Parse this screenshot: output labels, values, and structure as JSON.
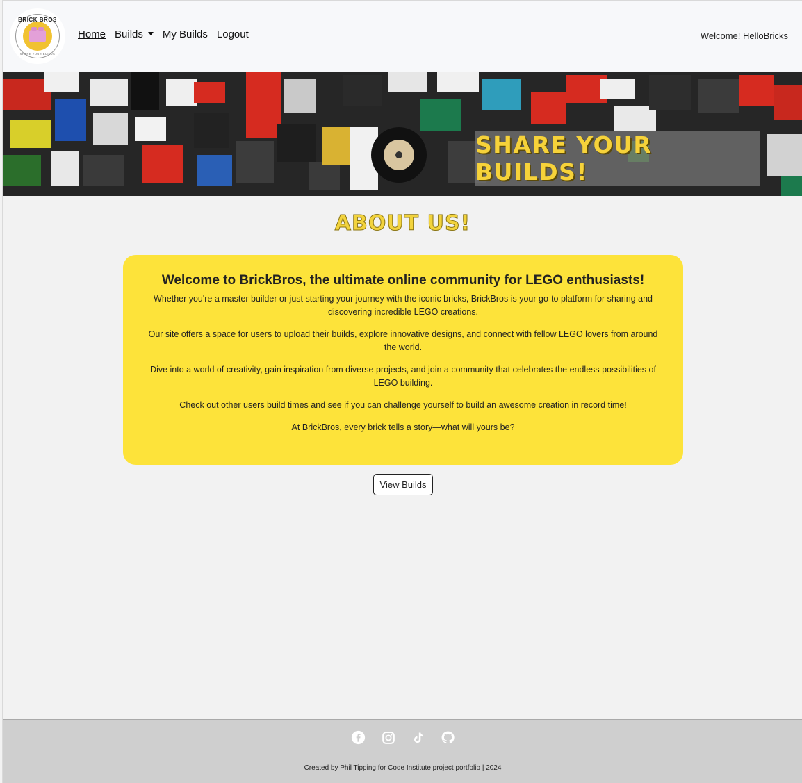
{
  "nav": {
    "logo_top_text": "BRICK BROS",
    "logo_bottom_text": "SHARE YOUR BUILDS",
    "links": [
      {
        "label": "Home"
      },
      {
        "label": "Builds"
      },
      {
        "label": "My Builds"
      },
      {
        "label": "Logout"
      }
    ],
    "welcome": "Welcome! HelloBricks"
  },
  "hero": {
    "banner_text": "SHARE YOUR BUILDS!"
  },
  "about": {
    "title": "ABOUT US!",
    "heading_prefix": "Welcome to ",
    "heading_brand": "BrickBros",
    "heading_suffix": ", the ultimate online community for LEGO enthusiasts!",
    "paragraphs": [
      "Whether you're a master builder or just starting your journey with the iconic bricks, BrickBros is your go-to platform for sharing and discovering incredible LEGO creations.",
      "Our site offers a space for users to upload their builds, explore innovative designs, and connect with fellow LEGO lovers from around the world.",
      "Dive into a world of creativity, gain inspiration from diverse projects, and join a community that celebrates the endless possibilities of LEGO building.",
      "Check out other users build times and see if you can challenge yourself to build an awesome creation in record time!",
      "At BrickBros, every brick tells a story—what will yours be?"
    ],
    "button_label": "View Builds"
  },
  "footer": {
    "icons": [
      "facebook-icon",
      "instagram-icon",
      "tiktok-icon",
      "github-icon"
    ],
    "credit": "Created by Phil Tipping for Code Institute project portfolio | 2024"
  },
  "colors": {
    "accent_yellow": "#fde33a",
    "title_yellow": "#f2d33d",
    "footer_bg": "#cfcfcf"
  }
}
